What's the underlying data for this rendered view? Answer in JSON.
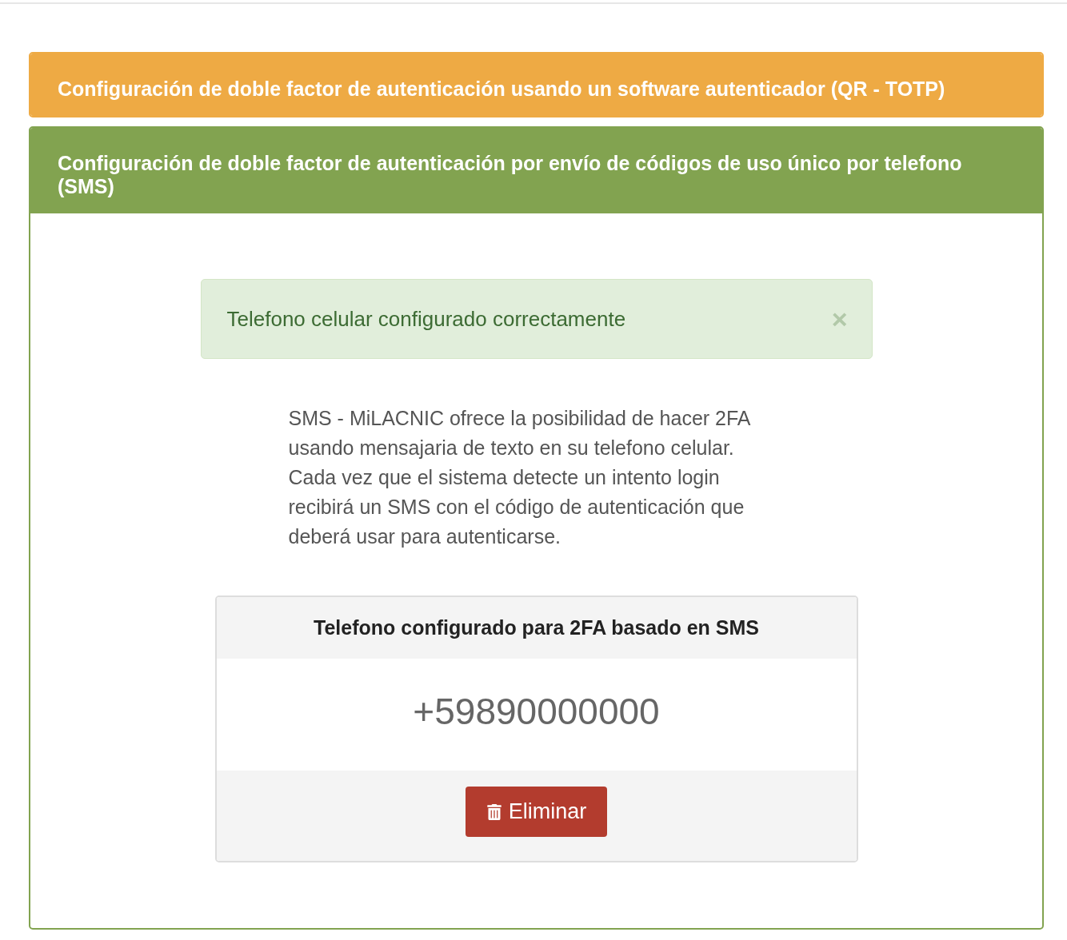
{
  "panels": [
    {
      "kind": "collapsed",
      "color": "#eeaa44",
      "title": "Configuración de doble factor de autenticación usando un software autenticador (QR - TOTP)"
    },
    {
      "kind": "expanded",
      "color": "#82a350",
      "title": "Configuración de doble factor de autenticación por envío de códigos de uso único por telefono (SMS)",
      "alert": {
        "message": "Telefono celular configurado correctamente",
        "close": "×"
      },
      "description": "SMS - MiLACNIC ofrece la posibilidad de hacer 2FA usando mensajaria de texto en su telefono celular. Cada vez que el sistema detecte un intento login recibirá un SMS con el código de autenticación que deberá usar para autenticarse.",
      "phone_card": {
        "title": "Telefono configurado para 2FA basado en SMS",
        "phone": "+59890000000",
        "button": "Eliminar"
      }
    }
  ]
}
